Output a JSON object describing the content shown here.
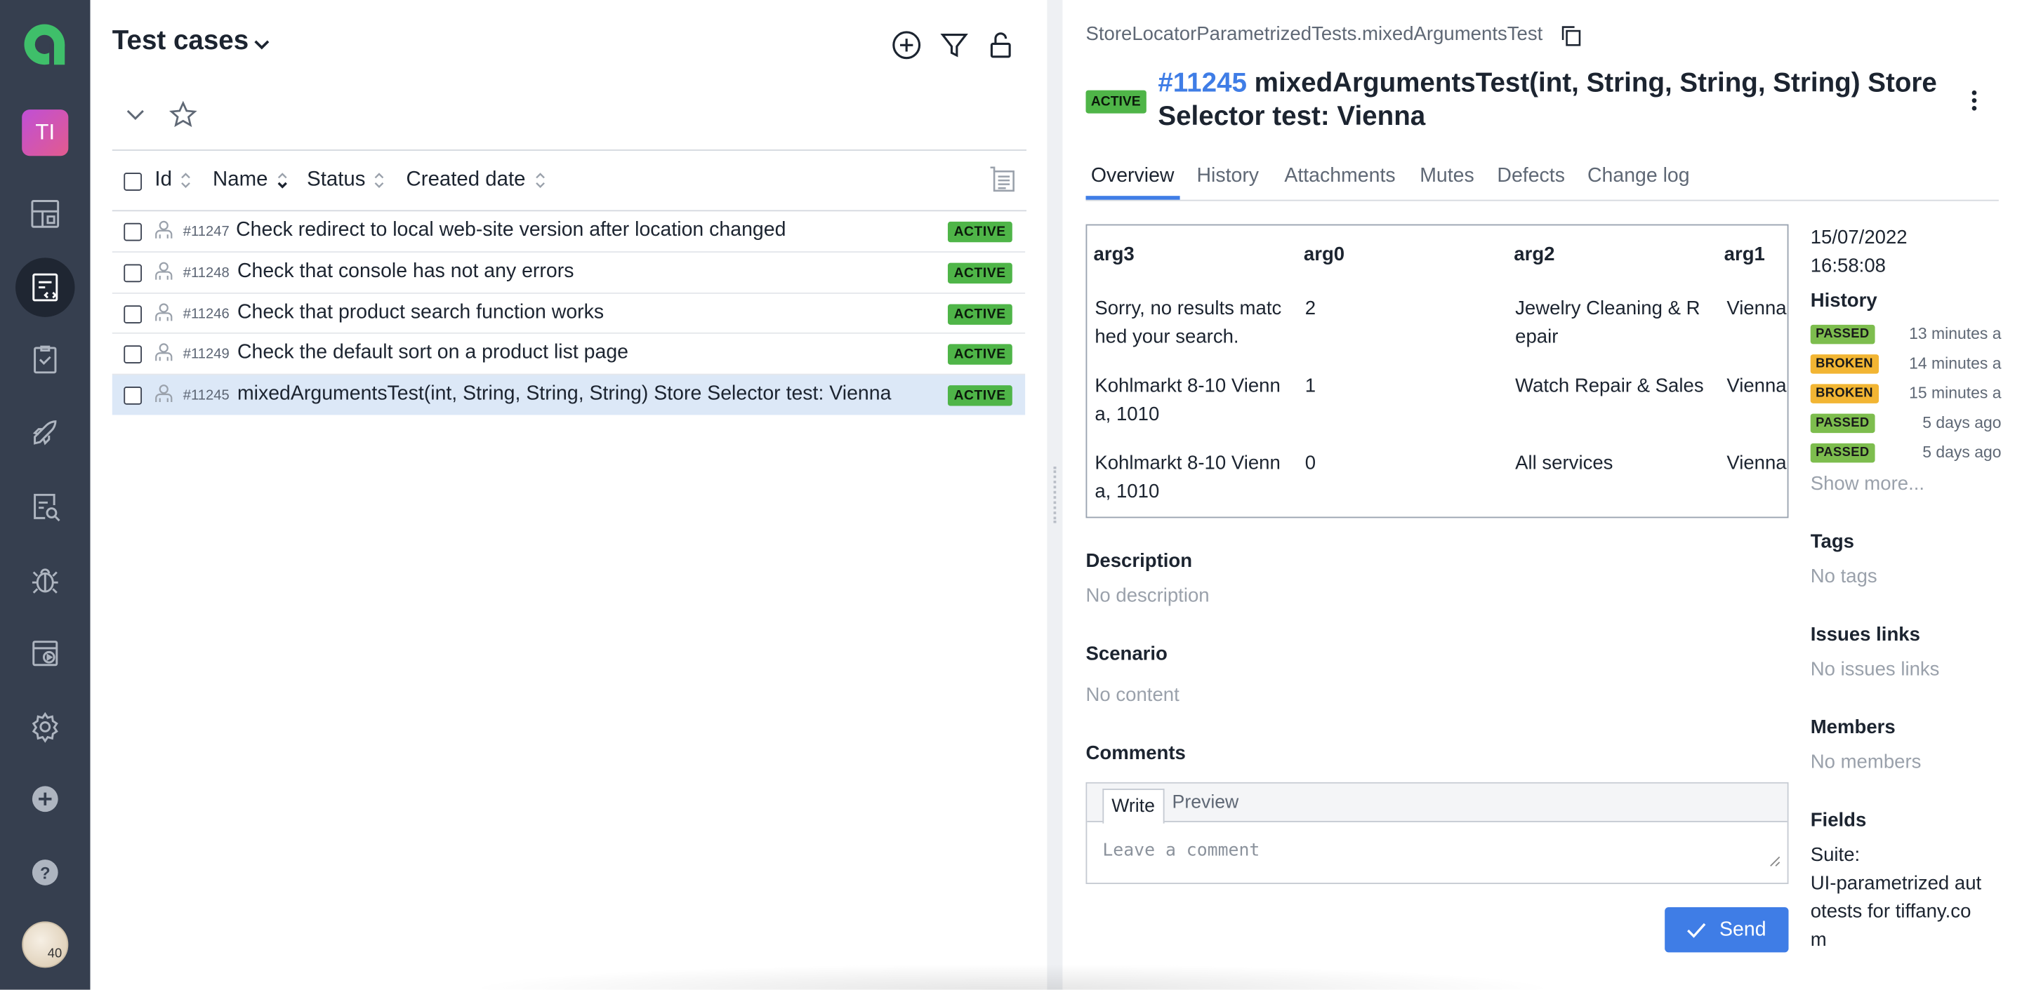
{
  "app": {
    "project_initials": "TI",
    "user_badge": "40"
  },
  "left": {
    "title": "Test cases",
    "columns": [
      "Id",
      "Name",
      "Status",
      "Created date"
    ],
    "rows": [
      {
        "id": "#11247",
        "name": "Check redirect to local web-site version after location changed",
        "status": "ACTIVE"
      },
      {
        "id": "#11248",
        "name": "Check that console has not any errors",
        "status": "ACTIVE"
      },
      {
        "id": "#11246",
        "name": "Check that product search function works",
        "status": "ACTIVE"
      },
      {
        "id": "#11249",
        "name": "Check the default sort on a product list page",
        "status": "ACTIVE"
      },
      {
        "id": "#11245",
        "name": "mixedArgumentsTest(int, String, String, String) Store Selector test: Vienna",
        "status": "ACTIVE",
        "selected": true
      }
    ]
  },
  "detail": {
    "breadcrumb": "StoreLocatorParametrizedTests.mixedArgumentsTest",
    "status": "ACTIVE",
    "id": "#11245",
    "title": "mixedArgumentsTest(int, String, String, String) Store Selector test: Vienna",
    "tabs": [
      "Overview",
      "History",
      "Attachments",
      "Mutes",
      "Defects",
      "Change log"
    ],
    "params": {
      "headers": [
        "arg3",
        "arg0",
        "arg2",
        "arg1"
      ],
      "rows": [
        [
          "Sorry, no results matc\nhed your search.",
          "2",
          "Jewelry Cleaning & R\nepair",
          "Vienna"
        ],
        [
          "Kohlmarkt 8-10 Vienn\na, 1010",
          "1",
          "Watch Repair & Sales",
          "Vienna"
        ],
        [
          "Kohlmarkt 8-10 Vienn\na, 1010",
          "0",
          "All services",
          "Vienna"
        ]
      ]
    },
    "description_title": "Description",
    "description_value": "No description",
    "scenario_title": "Scenario",
    "scenario_value": "No content",
    "comments_title": "Comments",
    "comment_write_tab": "Write",
    "comment_preview_tab": "Preview",
    "comment_placeholder": "Leave a comment",
    "send_label": "Send"
  },
  "side": {
    "created_date": "15/07/2022",
    "created_time": "16:58:08",
    "history_title": "History",
    "history": [
      {
        "status": "PASSED",
        "time": "13 minutes a"
      },
      {
        "status": "BROKEN",
        "time": "14 minutes a"
      },
      {
        "status": "BROKEN",
        "time": "15 minutes a"
      },
      {
        "status": "PASSED",
        "time": "5 days ago"
      },
      {
        "status": "PASSED",
        "time": "5 days ago"
      }
    ],
    "show_more": "Show more...",
    "tags_title": "Tags",
    "tags_value": "No tags",
    "issues_title": "Issues links",
    "issues_value": "No issues links",
    "members_title": "Members",
    "members_value": "No members",
    "fields_title": "Fields",
    "fields_label": "Suite:",
    "fields_value_lines": [
      "UI-parametrized aut",
      "otests for tiffany.co",
      "m"
    ]
  },
  "colors": {
    "sidebar": "#363f4f",
    "accent": "#3f7de6",
    "active_badge": "#4fb548",
    "passed": "#7dbd4e",
    "broken": "#f2b533"
  }
}
